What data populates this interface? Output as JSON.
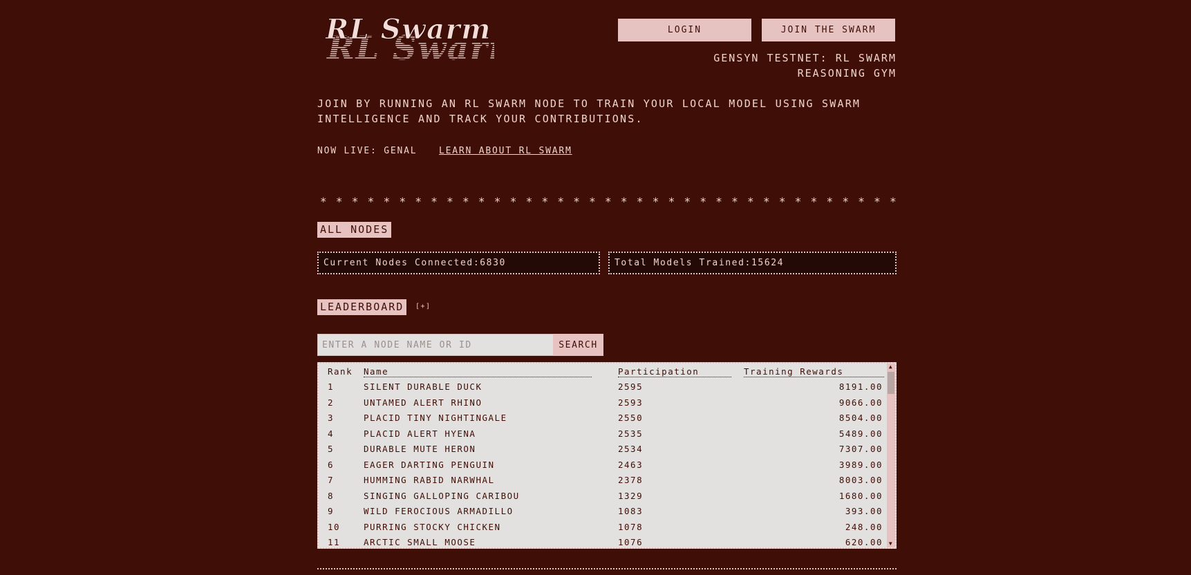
{
  "header": {
    "logo_text": "RL Swarm",
    "login_label": "LOGIN",
    "join_label": "JOIN THE SWARM",
    "network_line1": "GENSYN TESTNET: RL SWARM",
    "network_line2": "REASONING GYM"
  },
  "intro": {
    "text": "JOIN BY RUNNING AN RL SWARM NODE TO TRAIN YOUR LOCAL MODEL USING SWARM INTELLIGENCE AND TRACK YOUR CONTRIBUTIONS.",
    "live_label": "NOW LIVE: GENAL",
    "learn_link": "LEARN ABOUT RL SWARM"
  },
  "divider_stars": "* * * * * * * * * * * * * * * * * * * * * * * * * * * * * * * * * * * * *",
  "nodes": {
    "label": "ALL NODES",
    "connected_label": "Current Nodes Connected:",
    "connected_value": "6830",
    "trained_label": "Total Models Trained:",
    "trained_value": "15624"
  },
  "leaderboard": {
    "label": "LEADERBOARD",
    "expand_icon": "[+]",
    "search_placeholder": "ENTER A NODE NAME OR ID",
    "search_button": "SEARCH",
    "columns": [
      "Rank",
      "Name",
      "Participation",
      "Training Rewards"
    ],
    "rows": [
      {
        "rank": "1",
        "name": "SILENT DURABLE DUCK",
        "participation": "2595",
        "rewards": "8191.00"
      },
      {
        "rank": "2",
        "name": "UNTAMED ALERT RHINO",
        "participation": "2593",
        "rewards": "9066.00"
      },
      {
        "rank": "3",
        "name": "PLACID TINY NIGHTINGALE",
        "participation": "2550",
        "rewards": "8504.00"
      },
      {
        "rank": "4",
        "name": "PLACID ALERT HYENA",
        "participation": "2535",
        "rewards": "5489.00"
      },
      {
        "rank": "5",
        "name": "DURABLE MUTE HERON",
        "participation": "2534",
        "rewards": "7307.00"
      },
      {
        "rank": "6",
        "name": "EAGER DARTING PENGUIN",
        "participation": "2463",
        "rewards": "3989.00"
      },
      {
        "rank": "7",
        "name": "HUMMING RABID NARWHAL",
        "participation": "2378",
        "rewards": "8003.00"
      },
      {
        "rank": "8",
        "name": "SINGING GALLOPING CARIBOU",
        "participation": "1329",
        "rewards": "1680.00"
      },
      {
        "rank": "9",
        "name": "WILD FEROCIOUS ARMADILLO",
        "participation": "1083",
        "rewards": "393.00"
      },
      {
        "rank": "10",
        "name": "PURRING STOCKY CHICKEN",
        "participation": "1078",
        "rewards": "248.00"
      },
      {
        "rank": "11",
        "name": "ARCTIC SMALL MOOSE",
        "participation": "1076",
        "rewards": "620.00"
      }
    ]
  },
  "colors": {
    "background": "#3f0e06",
    "accent": "#e6c3c1",
    "text": "#f0d4cc",
    "panel": "#e3e1df"
  }
}
